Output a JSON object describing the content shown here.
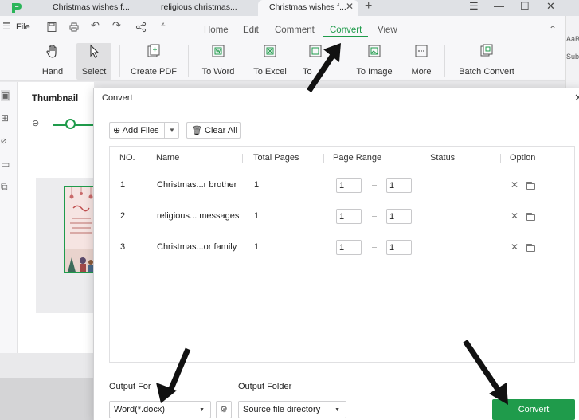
{
  "titlebar": {
    "tabs": [
      {
        "label": "Christmas wishes f..."
      },
      {
        "label": "religious christmas..."
      },
      {
        "label": "Christmas wishes f..."
      }
    ],
    "tab_close": "✕",
    "new_tab": "+"
  },
  "menubar": {
    "file_label": "File",
    "tabs": [
      "Home",
      "Edit",
      "Comment",
      "Convert",
      "View"
    ],
    "active_tab": "Convert"
  },
  "ribbon": {
    "buttons": [
      {
        "label": "Hand",
        "icon": "hand-icon"
      },
      {
        "label": "Select",
        "icon": "cursor-icon"
      },
      {
        "label": "Create PDF",
        "icon": "create-pdf-icon"
      },
      {
        "label": "To Word",
        "icon": "word-icon"
      },
      {
        "label": "To Excel",
        "icon": "excel-icon"
      },
      {
        "label": "To",
        "icon": "ppt-icon"
      },
      {
        "label": "To Image",
        "icon": "image-icon"
      },
      {
        "label": "More",
        "icon": "more-icon"
      },
      {
        "label": "Batch Convert",
        "icon": "batch-convert-icon"
      }
    ]
  },
  "right_partial": {
    "line1": "AaBb",
    "line2": "Sub"
  },
  "thumbnail_panel": {
    "title": "Thumbnail"
  },
  "dialog": {
    "title": "Convert",
    "close": "✕",
    "add_files_label": "Add Files",
    "clear_all_label": "Clear All",
    "columns": [
      "NO.",
      "Name",
      "Total Pages",
      "Page Range",
      "Status",
      "Option"
    ],
    "rows": [
      {
        "no": "1",
        "name": "Christmas...r brother",
        "total_pages": "1",
        "range_from": "1",
        "range_to": "1",
        "status": ""
      },
      {
        "no": "2",
        "name": "religious... messages",
        "total_pages": "1",
        "range_from": "1",
        "range_to": "1",
        "status": ""
      },
      {
        "no": "3",
        "name": "Christmas...or family",
        "total_pages": "1",
        "range_from": "1",
        "range_to": "1",
        "status": ""
      }
    ],
    "output_format_label": "Output For",
    "output_format_value": "Word(*.docx)",
    "output_folder_label": "Output Folder",
    "output_folder_value": "Source file directory",
    "convert_button": "Convert"
  },
  "colors": {
    "accent": "#1f9b4b"
  }
}
